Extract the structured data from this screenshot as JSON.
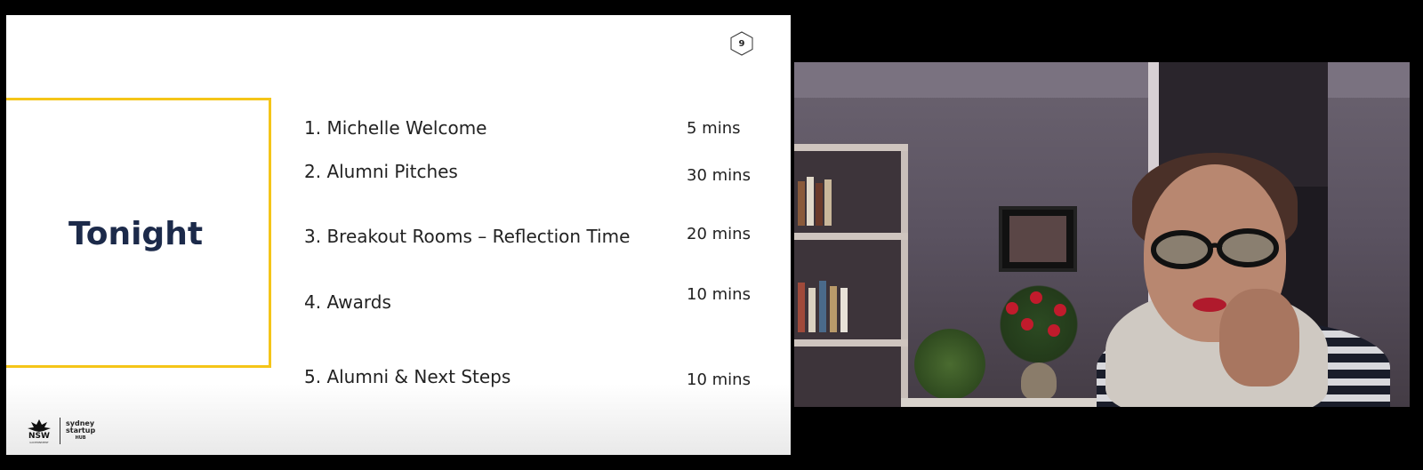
{
  "slide": {
    "page_number": "9",
    "title": "Tonight",
    "agenda": [
      {
        "item": "1. Michelle Welcome",
        "duration": "5 mins"
      },
      {
        "item": "2. Alumni Pitches",
        "duration": "30 mins"
      },
      {
        "item": "3. Breakout Rooms – Reflection Time",
        "duration": "20 mins"
      },
      {
        "item": "4. Awards",
        "duration": "10 mins"
      },
      {
        "item": "5. Alumni & Next Steps",
        "duration": "10 mins"
      }
    ],
    "logos": {
      "nsw": "NSW",
      "nsw_sub": "GOVERNMENT",
      "startup_line1": "sydney",
      "startup_line2": "startup",
      "startup_line3": "HUB"
    }
  },
  "colors": {
    "accent_yellow": "#f5c518",
    "title_navy": "#1c2a4a"
  }
}
